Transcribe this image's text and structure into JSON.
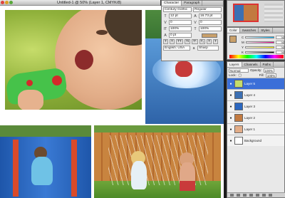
{
  "document": {
    "title": "Untitled-1 @ 50% (Layer 1, CMYK/8)"
  },
  "character_panel": {
    "tabs": [
      "Character",
      "Paragraph"
    ],
    "font_family": "Century Gothic",
    "font_style": "Regular",
    "size": "12 pt",
    "leading": "16.73 pt",
    "kerning": "0",
    "tracking": "0",
    "vertical_scale": "100%",
    "horizontal_scale": "100%",
    "baseline": "0 pt",
    "language": "English: USA",
    "antialias": "Sharp",
    "style_buttons": [
      "T",
      "T",
      "TT",
      "Tt",
      "T¹",
      "T₁",
      "T",
      "T"
    ]
  },
  "color_panel": {
    "tabs": [
      "Color",
      "Swatches",
      "Styles"
    ],
    "channels": [
      {
        "label": "C",
        "value": "%"
      },
      {
        "label": "M",
        "value": "%"
      },
      {
        "label": "Y",
        "value": "%"
      },
      {
        "label": "K",
        "value": "%"
      }
    ]
  },
  "layers_panel": {
    "tabs": [
      "Layers",
      "Channels",
      "Paths"
    ],
    "blend_mode": "Normal",
    "opacity_label": "Opacity:",
    "opacity": "100%",
    "lock_label": "Lock:",
    "fill_label": "Fill:",
    "fill": "100%",
    "layers": [
      {
        "name": "Layer 5",
        "active": true
      },
      {
        "name": "Layer 4",
        "active": false
      },
      {
        "name": "Layer 3",
        "active": false
      },
      {
        "name": "Layer 2",
        "active": false
      },
      {
        "name": "Layer 1",
        "active": false
      },
      {
        "name": "Background",
        "active": false
      }
    ]
  },
  "colors": {
    "selection": "#3b6fd8",
    "foreground": "#c9a06a",
    "nav_frame": "#dd3333"
  }
}
